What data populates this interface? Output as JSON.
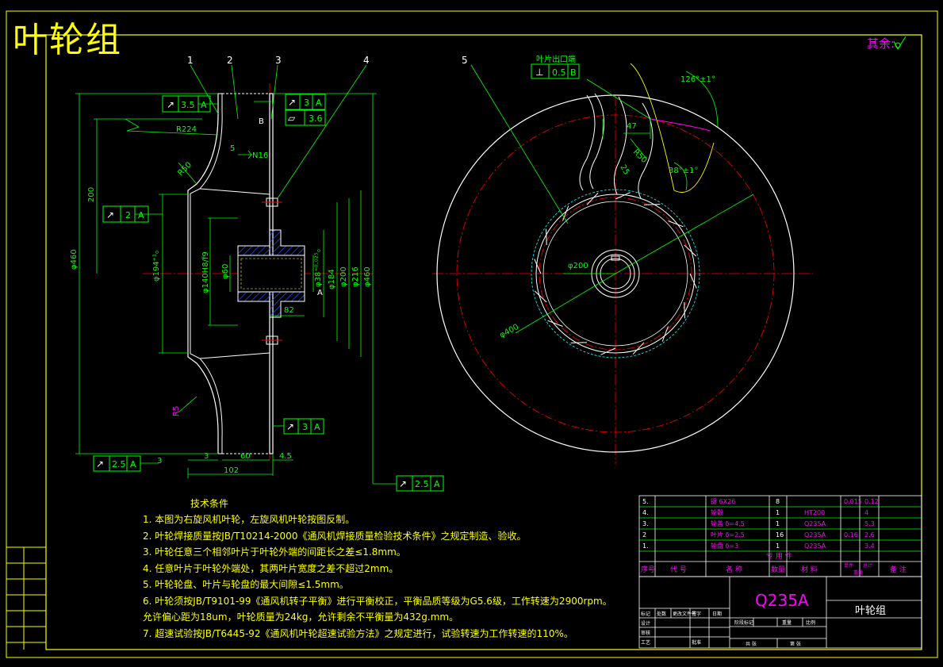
{
  "title": "叶轮组",
  "remainder_label": "其余:",
  "balloons": [
    "1",
    "2",
    "3",
    "4",
    "5"
  ],
  "front_view": {
    "fcf": {
      "top_left": {
        "sym": "↗",
        "value": "3.5",
        "datum": "A"
      },
      "top_right": {
        "sym": "↗",
        "value": "3",
        "datum": "A"
      },
      "flatness": {
        "sym": "▱",
        "value": "3.6"
      },
      "mid_left": {
        "sym": "↗",
        "value": "2",
        "datum": "A"
      },
      "bottom_right": {
        "sym": "↗",
        "value": "3",
        "datum": "A"
      },
      "bottom_left": {
        "sym": "↗",
        "value": "2.5",
        "datum": "A"
      },
      "far_right": {
        "sym": "↗",
        "value": "2.5",
        "datum": "A"
      }
    },
    "dims": {
      "r224": "R224",
      "r50": "R50",
      "d200": "200",
      "d460": "φ460",
      "d194": "φ194⁺¹₀",
      "d140": "φ140H8/f9",
      "d60": "φ60",
      "d38": "φ38⁺⁰·⁰²⁵₀",
      "d184": "φ184",
      "d200b": "φ200",
      "d216": "φ216",
      "d460b": "φ460",
      "d82": "82",
      "w3": "3",
      "w60": "60",
      "w45": "4.5",
      "w102": "102",
      "n16": "N16",
      "n5": "5",
      "datum_b": "B",
      "datum_a": "A",
      "r5": "R5",
      "w3b": "3"
    }
  },
  "side_view": {
    "tolerance_label": "叶片出口端",
    "fcf": {
      "sym": "⊥",
      "value": "0.5",
      "datum": "B"
    },
    "dims": {
      "a126": "126°±1°",
      "w47": "47",
      "r50": "R50",
      "a38": "38°±1°",
      "w25": "25",
      "d200": "φ200",
      "d400": "φ400"
    }
  },
  "notes": {
    "title": "技术条件",
    "items": [
      "1. 本图为右旋风机叶轮，左旋风机叶轮按图反制。",
      "2. 叶轮焊接质量按JB/T10214-2000《通风机焊接质量检验技术条件》之规定制造、验收。",
      "3. 叶轮任意三个相邻叶片于叶轮外端的间距长之差≤1.8mm。",
      "4. 任意叶片于叶轮外端处，其两叶片宽度之差不超过2mm。",
      "5. 叶轮轮盘、叶片与轮盘的最大间隙≤1.5mm。",
      "6. 叶轮须按JB/T9101-99《通风机转子平衡》进行平衡校正，平衡品质等级为G5.6级，工作转速为2900rpm。",
      "   允许偏心距为18um，叶轮质量为24kg，允许剩余不平衡量为432g.mm。",
      "7. 超速试验按JB/T6445-92《通风机叶轮超速试验方法》之规定进行，试验转速为工作转速的110%。"
    ]
  },
  "bom": {
    "rows": [
      {
        "seq": "5.",
        "code": "",
        "name": "键 6X26",
        "qty": "8",
        "material": "",
        "w1": "0.015",
        "w2": "0.12"
      },
      {
        "seq": "4.",
        "code": "",
        "name": "轮毂",
        "qty": "1",
        "material": "HT200",
        "w1": "",
        "w2": "4"
      },
      {
        "seq": "3.",
        "code": "",
        "name": "轮盖 δ=4.5",
        "qty": "1",
        "material": "Q235A",
        "w1": "",
        "w2": "5.3"
      },
      {
        "seq": "2",
        "code": "",
        "name": "叶片 δ=2.5",
        "qty": "16",
        "material": "Q235A",
        "w1": "0.16",
        "w2": "2.6"
      },
      {
        "seq": "1.",
        "code": "",
        "name": "轮盘 δ=3",
        "qty": "1",
        "material": "Q235A",
        "w1": "",
        "w2": "3.4"
      }
    ],
    "header_band": "专 用 件",
    "headers": {
      "seq": "序号",
      "code": "代 号",
      "name": "名 称",
      "qty": "数量",
      "material": "材 料",
      "w1": "单件",
      "w2": "总计",
      "weight": "重量",
      "note": "备 注"
    }
  },
  "title_block": {
    "material": "Q235A",
    "part_name": "叶轮组",
    "row_labels": [
      "标记",
      "处数",
      "更改文件号",
      "签字",
      "日期"
    ],
    "design": "设计",
    "check": "审核",
    "process": "工艺",
    "approve": "批准",
    "stage": "阶段标记",
    "weight": "重量",
    "scale": "比例",
    "sheets": "共  张",
    "sheet": "第  张"
  },
  "colors": {
    "frame": "#ffff00",
    "part": "#ffffff",
    "dim": "#00ff00",
    "center": "#ff0000",
    "hidden": "#00ffff",
    "hatch": "#0000ff",
    "magenta": "#ff00ff",
    "yellow": "#ffff00"
  }
}
